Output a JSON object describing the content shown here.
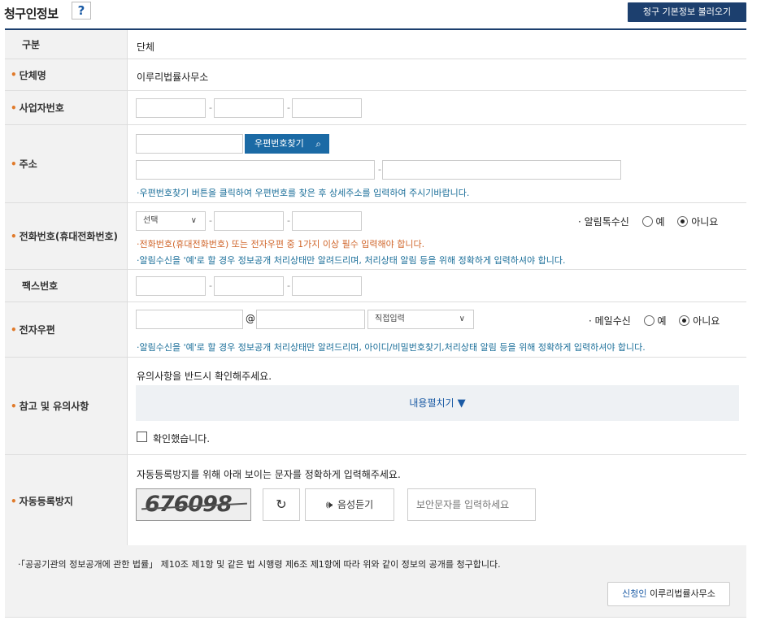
{
  "header": {
    "title": "청구인정보",
    "help_label": "?",
    "load_button": "청구 기본정보 불러오기"
  },
  "rows": {
    "category": {
      "label": "구분",
      "value": "단체"
    },
    "org_name": {
      "label": "단체명",
      "value": "이루리법률사무소"
    },
    "business_no": {
      "label": "사업자번호"
    },
    "address": {
      "label": "주소",
      "zip_button": "우편번호찾기",
      "note": "·우편번호찾기 버튼을 클릭하여 우편번호를 찾은 후 상세주소를 입력하여 주시기바랍니다."
    },
    "phone": {
      "label": "전화번호(휴대전화번호)",
      "select_value": "선택",
      "notify_label": "· 알림톡수신",
      "opt_yes": "예",
      "opt_no": "아니요",
      "notify_selected": "아니요",
      "note_required": "·전화번호(휴대전화번호) 또는 전자우편 중 1가지 이상 필수 입력해야 합니다.",
      "note_notify": "·알림수신을 '예'로 할 경우 정보공개 처리상태만 알려드리며, 처리상태 알림 등을 위해 정확하게 입력하셔야 합니다."
    },
    "fax": {
      "label": "팩스번호"
    },
    "email": {
      "label": "전자우편",
      "at": "@",
      "domain_select": "직접입력",
      "mail_label": "· 메일수신",
      "opt_yes": "예",
      "opt_no": "아니요",
      "mail_selected": "아니요",
      "note": "·알림수신을 '예'로 할 경우 정보공개 처리상태만 알려드리며, 아이디/비밀번호찾기,처리상태 알림 등을 위해 정확하게 입력하셔야 합니다."
    },
    "notice": {
      "label": "참고 및 유의사항",
      "instruction": "유의사항을 반드시 확인해주세요.",
      "expand": "내용펼치기",
      "confirm": "확인했습니다.",
      "confirmed": false
    },
    "captcha": {
      "label": "자동등록방지",
      "instruction": "자동등록방지를 위해 아래 보이는 문자를 정확하게 입력해주세요.",
      "code": "676098",
      "audio_button": "음성듣기",
      "input_placeholder": "보안문자를 입력하세요"
    }
  },
  "footer": {
    "law": "·「공공기관의 정보공개에 관한 법률」 제10조 제1항 및 같은 법 시행령 제6조 제1항에 따라 위와 같이 정보의 공개를 청구합니다.",
    "applicant_label": "신청인",
    "applicant_value": "이루리법률사무소"
  },
  "colors": {
    "accent": "#1c3f6e",
    "button_blue": "#1b6aa5",
    "required_star": "#e07a2a",
    "note_blue": "#1a6e99",
    "note_orange": "#d0652a"
  },
  "icons": [
    "search-icon",
    "refresh-icon",
    "speaker-icon",
    "triangle-down-icon",
    "chevron-down-icon"
  ]
}
